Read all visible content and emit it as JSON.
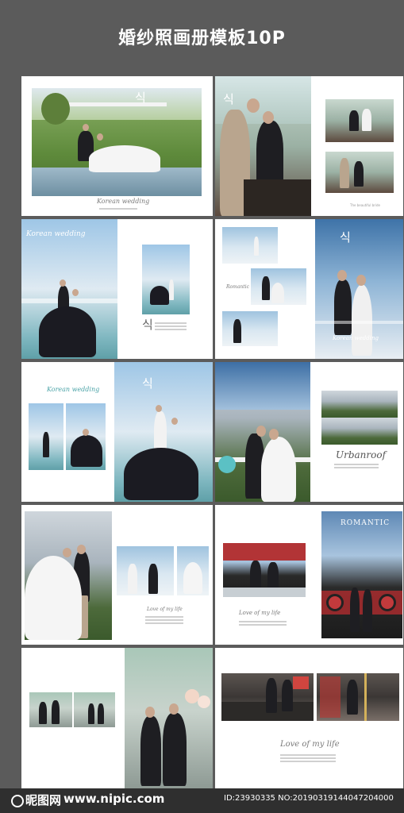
{
  "header": {
    "title": "婚纱照画册模板10P"
  },
  "spreads": {
    "p1": {
      "script": "Korean wedding",
      "korean": "식",
      "caption": "The beautiful bride"
    },
    "p2": {
      "script": "Korean wedding",
      "korean": "식",
      "romantic": "Romantic"
    },
    "p3": {
      "script": "Korean wedding",
      "korean": "식",
      "urban": "Urbanroof"
    },
    "p4": {
      "romantic": "ROMANTIC",
      "love": "Love of my life"
    },
    "p5": {
      "love": "Love of my life"
    }
  },
  "footer": {
    "logo": "昵图网",
    "url": "www.nipic.com",
    "meta": "ID:23930335 NO:20190319144047204000"
  }
}
